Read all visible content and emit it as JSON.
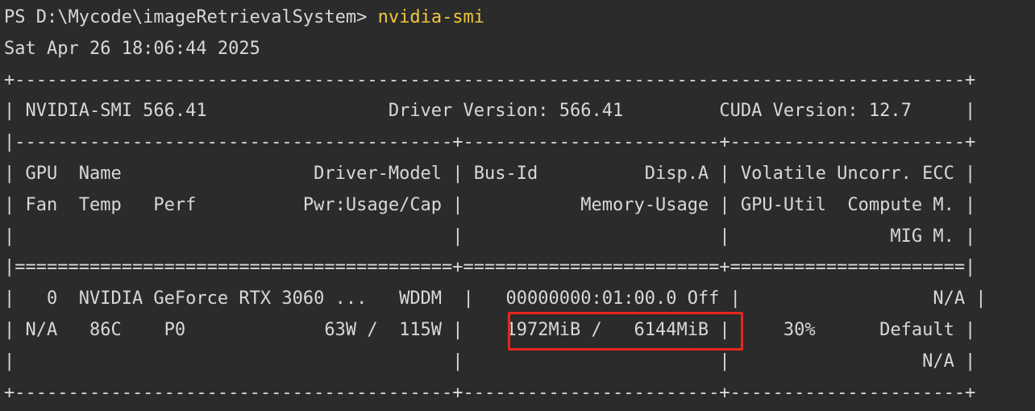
{
  "prompt": {
    "text": "PS D:\\Mycode\\imageRetrievalSystem> ",
    "command": "nvidia-smi"
  },
  "timestamp": "Sat Apr 26 18:06:44 2025",
  "output_lines": [
    "+-----------------------------------------------------------------------------------------+",
    "| NVIDIA-SMI 566.41                 Driver Version: 566.41         CUDA Version: 12.7     |",
    "|-----------------------------------------+------------------------+----------------------+",
    "| GPU  Name                  Driver-Model | Bus-Id          Disp.A | Volatile Uncorr. ECC |",
    "| Fan  Temp   Perf          Pwr:Usage/Cap |           Memory-Usage | GPU-Util  Compute M. |",
    "|                                         |                        |               MIG M. |",
    "|=========================================+========================+======================|",
    "|   0  NVIDIA GeForce RTX 3060 ...   WDDM  |   00000000:01:00.0 Off |                  N/A |",
    "| N/A   86C    P0             63W /  115W |    1972MiB /   6144MiB |     30%      Default |",
    "|                                         |                        |                  N/A |",
    "+-----------------------------------------+------------------------+----------------------+"
  ]
}
